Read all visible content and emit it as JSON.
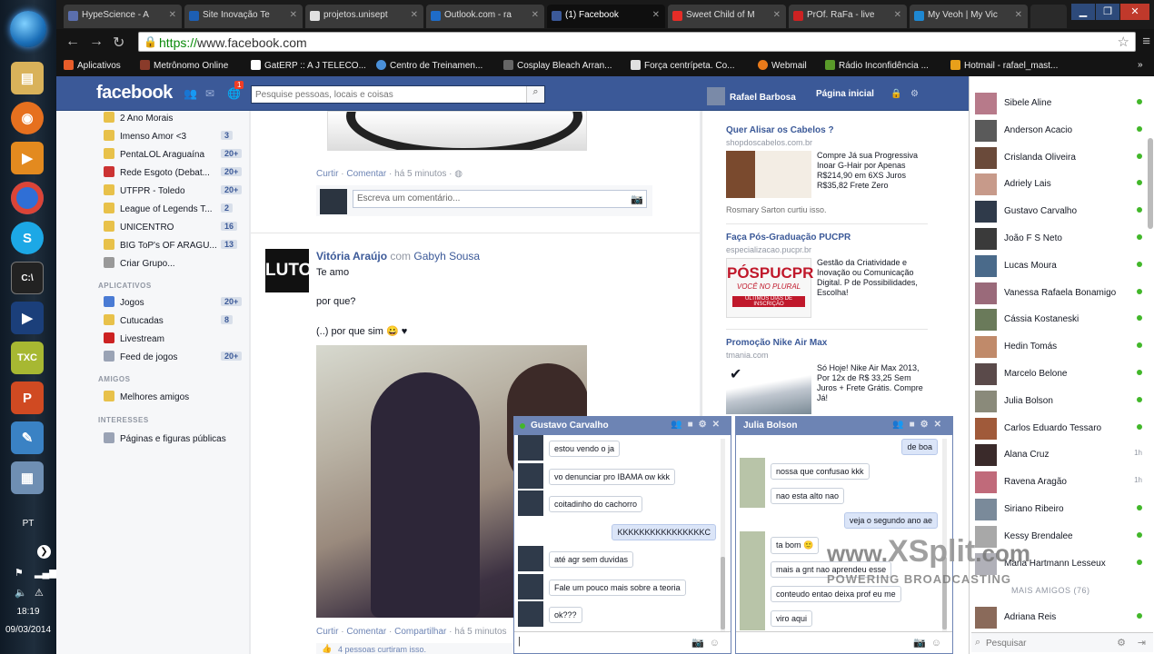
{
  "taskbar": {
    "lang": "PT",
    "time": "18:19",
    "date": "09/03/2014"
  },
  "browser": {
    "tabs": [
      {
        "label": "HypeScience - A",
        "color": "#5b6fae"
      },
      {
        "label": "Site Inovação Te",
        "color": "#1d5fb4"
      },
      {
        "label": "projetos.unisept",
        "color": "#e0e0e0"
      },
      {
        "label": "Outlook.com - ra",
        "color": "#1f6cc8"
      },
      {
        "label": "(1) Facebook",
        "color": "#3b5998",
        "active": true
      },
      {
        "label": "Sweet Child of M",
        "color": "#e52d27"
      },
      {
        "label": "PrOf. RaFa - live",
        "color": "#cc2222"
      },
      {
        "label": "My Veoh | My Vic",
        "color": "#1e88d2"
      }
    ],
    "url_scheme": "https://",
    "url_rest": "www.facebook.com",
    "bookmarks": [
      {
        "label": "Aplicativos",
        "color": "#e85d2a"
      },
      {
        "label": "Metrônomo Online",
        "color": "#8a3b2a"
      },
      {
        "label": "GatERP :: A J TELECO...",
        "color": "#ffffff"
      },
      {
        "label": "Centro de Treinamen...",
        "color": "#4a90d9"
      },
      {
        "label": "Cosplay Bleach Arran...",
        "color": "#666666"
      },
      {
        "label": "Força centrípeta. Co...",
        "color": "#e0e0e0"
      },
      {
        "label": "Webmail",
        "color": "#e87a1a"
      },
      {
        "label": "Rádio Inconfidência ...",
        "color": "#5a9a2a"
      },
      {
        "label": "Hotmail - rafael_mast...",
        "color": "#e8a01a"
      }
    ]
  },
  "fb": {
    "logo": "facebook",
    "notif_count": "1",
    "search_placeholder": "Pesquise pessoas, locais e coisas",
    "user_name": "Rafael Barbosa",
    "home_label": "Página inicial",
    "left_nav": [
      {
        "label": "2 Ano Morais",
        "count": "",
        "color": "#e8c14a"
      },
      {
        "label": "Imenso Amor <3",
        "count": "3",
        "color": "#e8c14a"
      },
      {
        "label": "PentaLOL Araguaína",
        "count": "20+",
        "color": "#e8c14a"
      },
      {
        "label": "Rede Esgoto (Debat...",
        "count": "20+",
        "color": "#cc3333"
      },
      {
        "label": "UTFPR - Toledo",
        "count": "20+",
        "color": "#e8c14a"
      },
      {
        "label": "League of Legends T...",
        "count": "2",
        "color": "#e8c14a"
      },
      {
        "label": "UNICENTRO",
        "count": "16",
        "color": "#e8c14a"
      },
      {
        "label": "BIG ToP's OF ARAGU...",
        "count": "13",
        "color": "#e8c14a"
      },
      {
        "label": "Criar Grupo...",
        "count": "",
        "color": "#999999"
      }
    ],
    "apps_heading": "APLICATIVOS",
    "apps": [
      {
        "label": "Jogos",
        "count": "20+",
        "color": "#4a7bd4"
      },
      {
        "label": "Cutucadas",
        "count": "8",
        "color": "#e8c14a"
      },
      {
        "label": "Livestream",
        "count": "",
        "color": "#cc2222"
      },
      {
        "label": "Feed de jogos",
        "count": "20+",
        "color": "#9aa3b5"
      }
    ],
    "friends_heading": "AMIGOS",
    "friends_item": "Melhores amigos",
    "interests_heading": "INTERESSES",
    "interests_item": "Páginas e figuras públicas",
    "post1_actions": {
      "curtir": "Curtir",
      "comentar": "Comentar",
      "time": "há 5 minutos"
    },
    "comment_placeholder": "Escreva um comentário...",
    "post2": {
      "avatar_text": "LUTO",
      "author": "Vitória Araújo",
      "with": "com",
      "tagged": "Gabyh Sousa",
      "line1": "Te amo",
      "line2": "por que?",
      "line3": "(..) por que sim 😀 ♥"
    },
    "post2_actions": {
      "curtir": "Curtir",
      "comentar": "Comentar",
      "compartilhar": "Compartilhar",
      "time": "há 5 minutos"
    },
    "likes": "4 pessoas curtiram isso.",
    "ads": [
      {
        "title": "Quer Alisar os Cabelos ?",
        "domain": "shopdoscabelos.com.br",
        "text": "Compre Já sua Progressiva Inoar G-Hair por Apenas R$214,90 em 6XS Juros R$35,82 Frete Zero",
        "note": "Rosmary Sarton curtiu isso."
      },
      {
        "title": "Faça Pós-Graduação PUCPR",
        "domain": "especializacao.pucpr.br",
        "text": "Gestão da Criatividade e Inovação ou Comunicação Digital. P de Possibilidades, Escolha!",
        "img_text": "PÓSPUCPR",
        "img_sub": "VOCÊ NO PLURAL",
        "img_band": "ÚLTIMOS DIAS DE INSCRIÇÃO"
      },
      {
        "title": "Promoção Nike Air Max",
        "domain": "tmania.com",
        "text": "Só Hoje! Nike Air Max 2013, Por 12x de R$ 33,25 Sem Juros + Frete Grátis. Compre Já!"
      }
    ]
  },
  "chat_sidebar": {
    "friends": [
      {
        "name": "Sibele Aline",
        "status": "online"
      },
      {
        "name": "Anderson Acacio",
        "status": "online"
      },
      {
        "name": "Crislanda Oliveira",
        "status": "online"
      },
      {
        "name": "Adriely Lais",
        "status": "online"
      },
      {
        "name": "Gustavo Carvalho",
        "status": "online"
      },
      {
        "name": "João F S Neto",
        "status": "online"
      },
      {
        "name": "Lucas Moura",
        "status": "online"
      },
      {
        "name": "Vanessa Rafaela Bonamigo",
        "status": "online"
      },
      {
        "name": "Cássia Kostaneski",
        "status": "online"
      },
      {
        "name": "Hedin Tomás",
        "status": "online"
      },
      {
        "name": "Marcelo Belone",
        "status": "online"
      },
      {
        "name": "Julia Bolson",
        "status": "online"
      },
      {
        "name": "Carlos Eduardo Tessaro",
        "status": "online"
      },
      {
        "name": "Alana Cruz",
        "status": "1h"
      },
      {
        "name": "Ravena Aragão",
        "status": "1h"
      },
      {
        "name": "Siriano Ribeiro",
        "status": "online"
      },
      {
        "name": "Kessy Brendalee",
        "status": "online"
      },
      {
        "name": "Maria Hartmann Lesseux",
        "status": "online"
      }
    ],
    "more_heading": "MAIS AMIGOS (76)",
    "more_friend": "Adriana Reis",
    "search_placeholder": "Pesquisar"
  },
  "chat1": {
    "name": "Gustavo Carvalho",
    "messages": [
      {
        "dir": "in",
        "text": "estou vendo o ja"
      },
      {
        "dir": "in",
        "text": "vo denunciar pro IBAMA ow kkk"
      },
      {
        "dir": "in",
        "text": "coitadinho do cachorro"
      },
      {
        "dir": "out",
        "text": "KKKKKKKKKKKKKKKKC"
      },
      {
        "dir": "in",
        "text": "até agr sem duvidas"
      },
      {
        "dir": "in",
        "text": "Fale um pouco mais sobre a teoria"
      },
      {
        "dir": "in",
        "text": "ok???"
      }
    ]
  },
  "chat2": {
    "name": "Julia Bolson",
    "messages": [
      {
        "dir": "out",
        "text": "de boa"
      },
      {
        "dir": "in",
        "text": "nossa que confusao kkk"
      },
      {
        "dir": "in",
        "text": "nao esta alto nao"
      },
      {
        "dir": "out",
        "text": "veja o segundo ano ae"
      },
      {
        "dir": "in",
        "text": "ta bom 🙂"
      },
      {
        "dir": "in",
        "text": "mais a gnt nao aprendeu esse"
      },
      {
        "dir": "in",
        "text": "conteudo entao deixa prof eu me"
      },
      {
        "dir": "in",
        "text": "viro aqui"
      }
    ]
  },
  "watermark": {
    "prefix": "www.",
    "brand": "XSplit",
    "suffix": ".com",
    "sub": "POWERING BROADCASTING"
  },
  "colors": {
    "fb_blue": "#3b5998",
    "online": "#42b72a"
  }
}
